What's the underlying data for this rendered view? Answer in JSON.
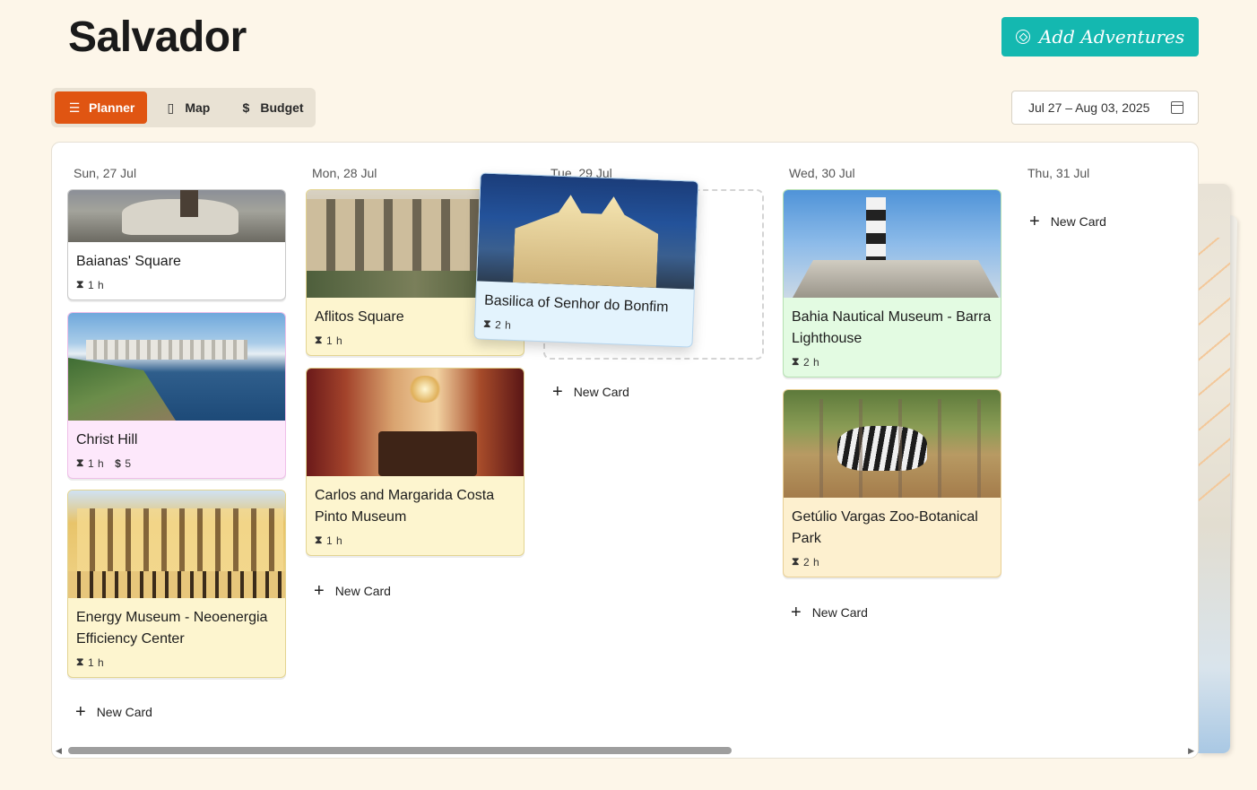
{
  "header": {
    "title": "Salvador",
    "add_button_label": "Add Adventures"
  },
  "tabs": [
    {
      "label": "Planner",
      "icon": "list-icon",
      "active": true
    },
    {
      "label": "Map",
      "icon": "map-icon",
      "active": false
    },
    {
      "label": "Budget",
      "icon": "dollar-icon",
      "active": false
    }
  ],
  "date_range": "Jul 27 – Aug 03, 2025",
  "new_card_label": "New Card",
  "columns": [
    {
      "day": "Sun, 27 Jul",
      "cards": [
        {
          "name": "Baianas' Square",
          "duration": "1 h",
          "cost": null,
          "color": "#ffffff"
        },
        {
          "name": "Christ Hill",
          "duration": "1 h",
          "cost": "5",
          "color": "#fde8fb"
        },
        {
          "name": "Energy Museum - Neoenergia Efficiency Center",
          "duration": "1 h",
          "cost": null,
          "color": "#fdf5cf"
        }
      ]
    },
    {
      "day": "Mon, 28 Jul",
      "cards": [
        {
          "name": "Aflitos Square",
          "duration": "1 h",
          "cost": null,
          "color": "#fdf5cf"
        },
        {
          "name": "Carlos and Margarida Costa Pinto Museum",
          "duration": "1 h",
          "cost": null,
          "color": "#fdf5cf"
        }
      ]
    },
    {
      "day": "Tue, 29 Jul",
      "cards": [],
      "dragging": {
        "name": "Basilica of Senhor do Bonfim",
        "duration": "2 h",
        "color": "#e3f3fd"
      }
    },
    {
      "day": "Wed, 30 Jul",
      "cards": [
        {
          "name": "Bahia Nautical Museum - Barra Lighthouse",
          "duration": "2 h",
          "cost": null,
          "color": "#e3fbe2"
        },
        {
          "name": "Getúlio Vargas Zoo-Botanical Park",
          "duration": "2 h",
          "cost": null,
          "color": "#fdf0cf"
        }
      ]
    },
    {
      "day": "Thu, 31 Jul",
      "cards": []
    }
  ],
  "icons": {
    "duration": "hourglass-icon",
    "cost": "dollar-icon",
    "add": "plus-icon"
  }
}
